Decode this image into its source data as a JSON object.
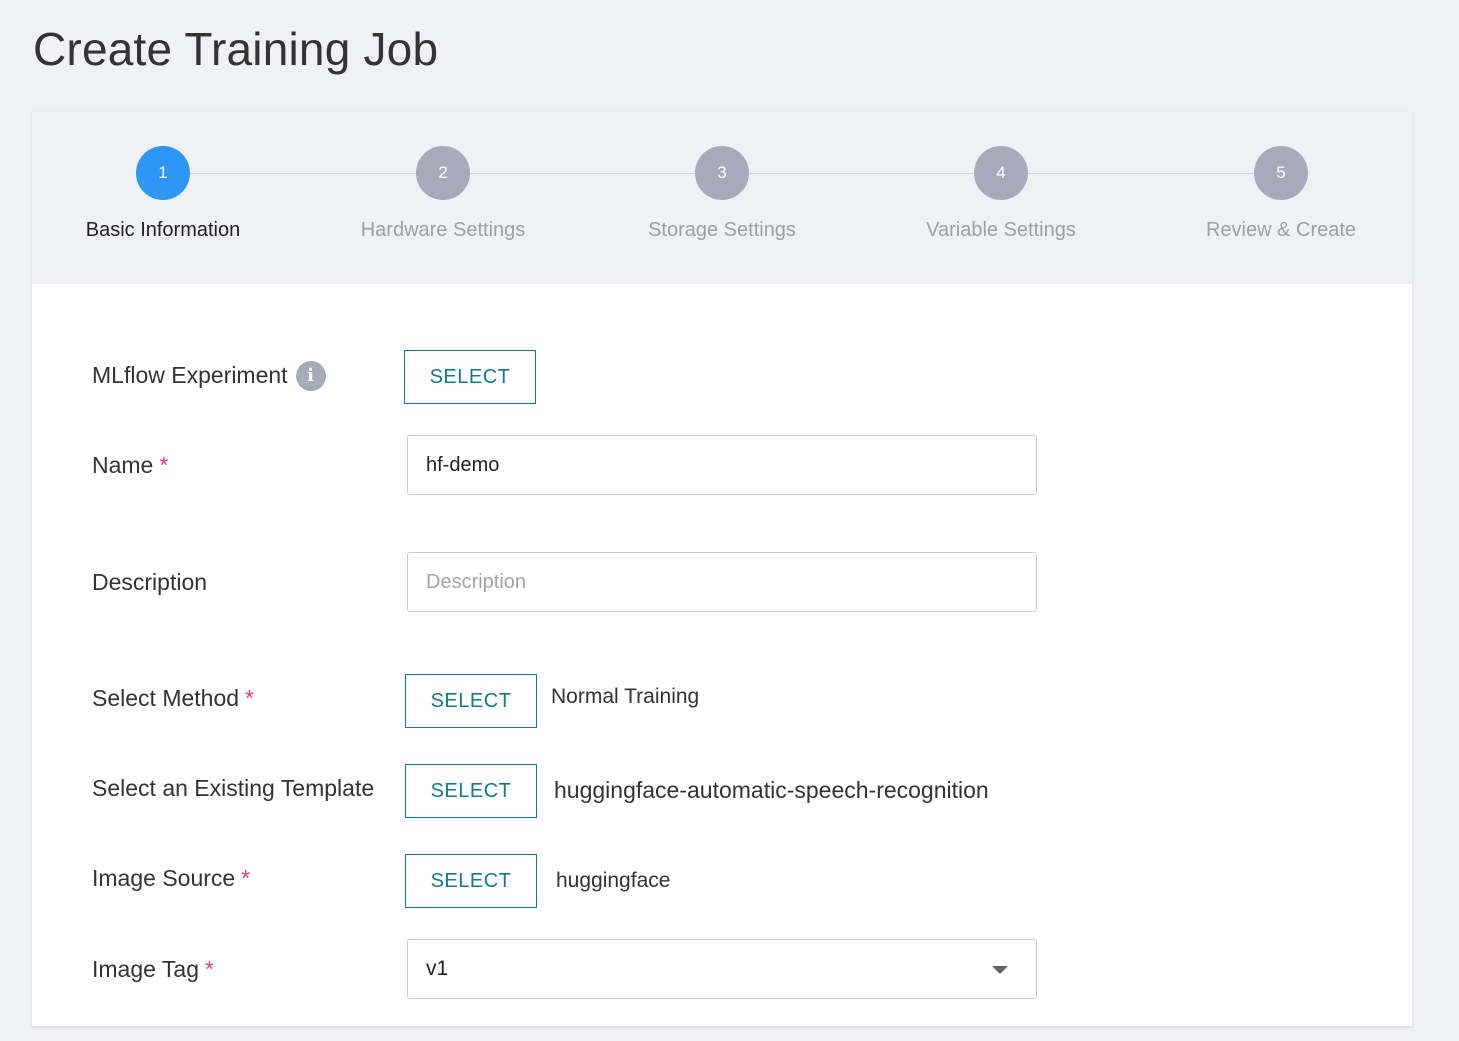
{
  "page": {
    "title": "Create Training Job"
  },
  "stepper": {
    "steps": [
      {
        "number": "1",
        "label": "Basic Information",
        "active": true
      },
      {
        "number": "2",
        "label": "Hardware Settings",
        "active": false
      },
      {
        "number": "3",
        "label": "Storage Settings",
        "active": false
      },
      {
        "number": "4",
        "label": "Variable Settings",
        "active": false
      },
      {
        "number": "5",
        "label": "Review & Create",
        "active": false
      }
    ]
  },
  "form": {
    "mlflow": {
      "label": "MLflow Experiment",
      "info_icon": "i",
      "button": "SELECT"
    },
    "name": {
      "label": "Name",
      "required": "*",
      "value": "hf-demo"
    },
    "description": {
      "label": "Description",
      "placeholder": "Description",
      "value": ""
    },
    "method": {
      "label": "Select Method",
      "required": "*",
      "button": "SELECT",
      "selected": "Normal Training"
    },
    "template": {
      "label": "Select an Existing Template",
      "button": "SELECT",
      "selected": "huggingface-automatic-speech-recognition"
    },
    "image_source": {
      "label": "Image Source",
      "required": "*",
      "button": "SELECT",
      "selected": "huggingface"
    },
    "image_tag": {
      "label": "Image Tag",
      "required": "*",
      "selected": "v1"
    }
  },
  "colors": {
    "accent": "#137a86",
    "active_step": "#2e97f5",
    "inactive_step": "#a6abbb",
    "required": "#e0407b"
  }
}
